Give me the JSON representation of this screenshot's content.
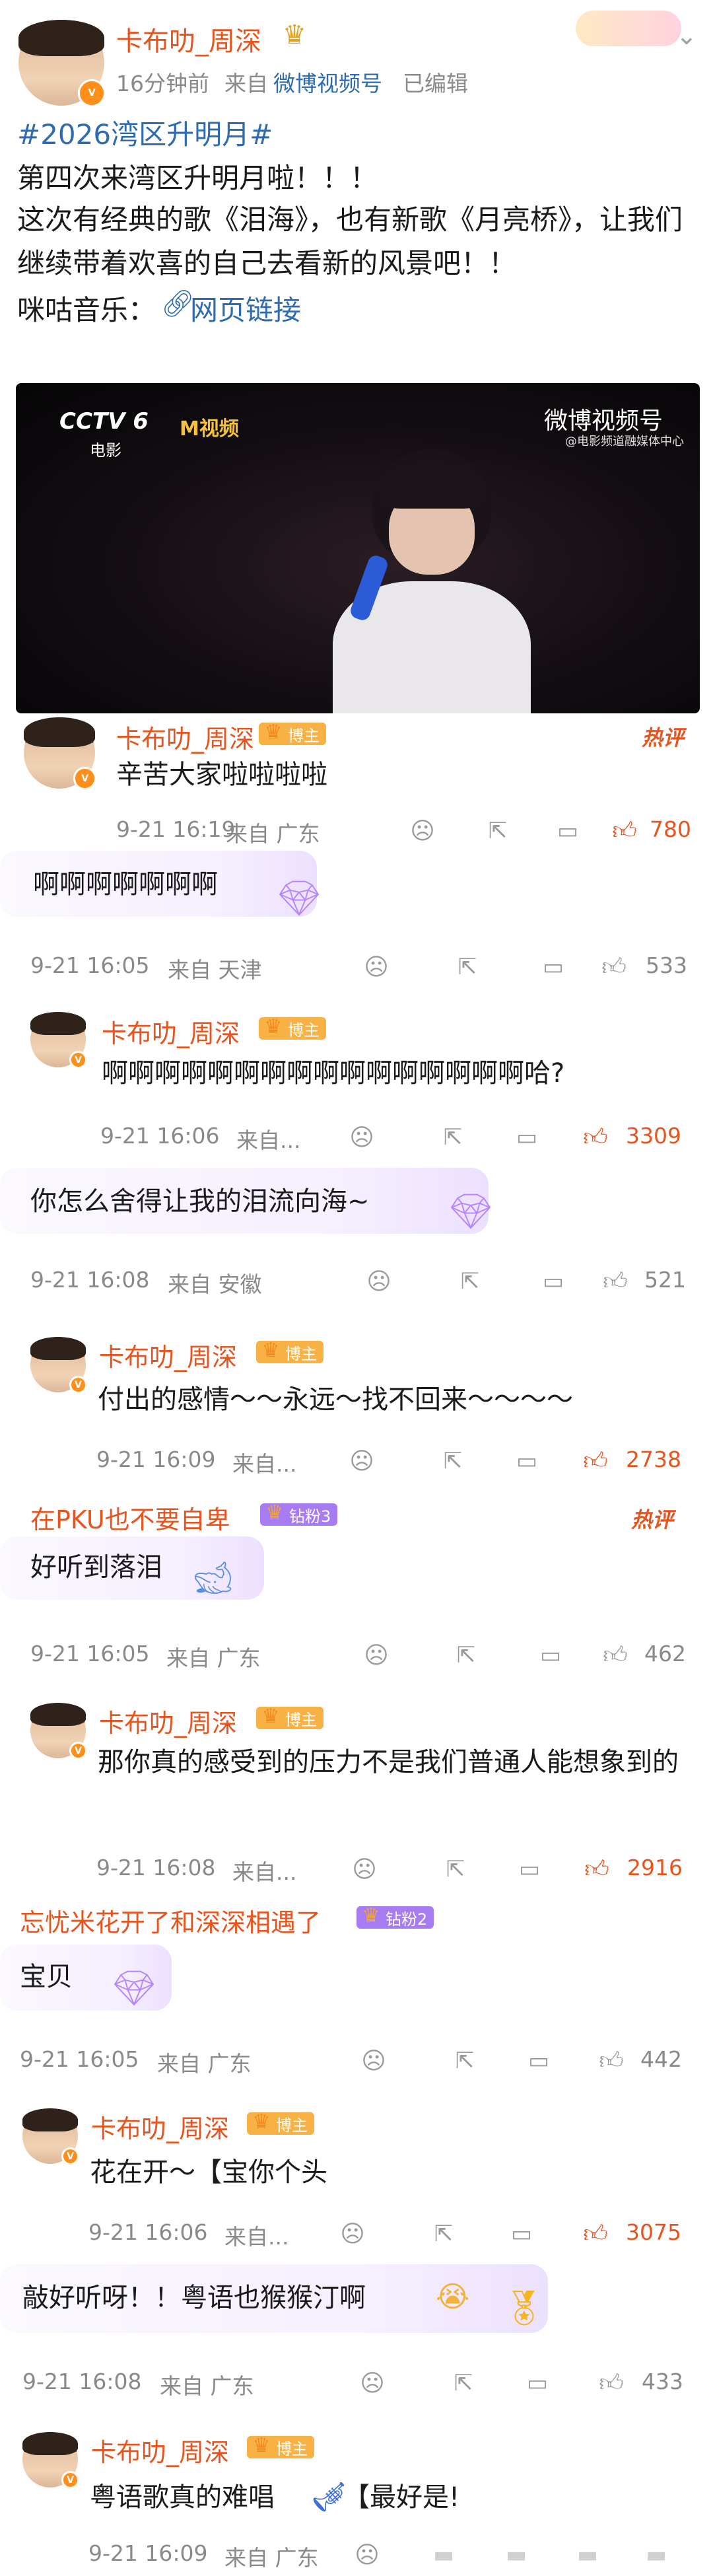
{
  "post": {
    "author": "卡布叻_周深",
    "time": "16分钟前",
    "source_prefix": "来自",
    "source": "微博视频号",
    "edited": "已编辑",
    "hashtag": "#2026湾区升明月#",
    "line1": "第四次来湾区升明月啦！！！",
    "line2": "这次有经典的歌《泪海》，也有新歌《月亮桥》，让我们继续带着欢喜的自己去看新的风景吧！！",
    "music_label": "咪咕音乐：",
    "web_link": "网页链接",
    "video": {
      "channel_logo": "CCTV 6",
      "channel_sub": "电影",
      "brand2": "M视频",
      "weibo_video": "微博视频号",
      "weibo_video_sub": "@电影频道融媒体中心"
    }
  },
  "hot_label": "热评",
  "comments": [
    {
      "author": "卡布叻_周深",
      "badge": "博主",
      "text": "辛苦大家啦啦啦啦",
      "time": "9-21 16:19",
      "loc": "来自 广东",
      "likes": "780",
      "hot": true,
      "reply": false
    },
    {
      "author": "",
      "badge": "",
      "text": "啊啊啊啊啊啊啊",
      "time": "9-21 16:05",
      "loc": "来自 天津",
      "likes": "533",
      "hot": false,
      "reply": false
    },
    {
      "author": "卡布叻_周深",
      "badge": "博主",
      "text": "啊啊啊啊啊啊啊啊啊啊啊啊啊啊啊啊哈?",
      "time": "9-21 16:06",
      "loc": "来自...",
      "likes": "3309",
      "hot": true,
      "reply": true
    },
    {
      "author": "",
      "badge": "",
      "text": "你怎么舍得让我的泪流向海~",
      "time": "9-21 16:08",
      "loc": "来自 安徽",
      "likes": "521",
      "hot": false,
      "reply": false
    },
    {
      "author": "卡布叻_周深",
      "badge": "博主",
      "text": "付出的感情～～永远～找不回来～～～～",
      "time": "9-21 16:09",
      "loc": "来自...",
      "likes": "2738",
      "hot": true,
      "reply": true
    },
    {
      "author": "在PKU也不要自卑",
      "badge": "钻粉3",
      "text": "好听到落泪",
      "time": "9-21 16:05",
      "loc": "来自 广东",
      "likes": "462",
      "hot": false,
      "reply": false
    },
    {
      "author": "卡布叻_周深",
      "badge": "博主",
      "text": "那你真的感受到的压力不是我们普通人能想象到的",
      "time": "9-21 16:08",
      "loc": "来自...",
      "likes": "2916",
      "hot": true,
      "reply": true
    },
    {
      "author": "忘忧米花开了和深深相遇了",
      "badge": "钻粉2",
      "text": "宝贝",
      "time": "9-21 16:05",
      "loc": "来自 广东",
      "likes": "442",
      "hot": false,
      "reply": false
    },
    {
      "author": "卡布叻_周深",
      "badge": "博主",
      "text": "花在开～【宝你个头",
      "time": "9-21 16:06",
      "loc": "来自...",
      "likes": "3075",
      "hot": true,
      "reply": true
    },
    {
      "author": "",
      "badge": "",
      "text": "敲好听呀！！粤语也猴猴汀啊",
      "time": "9-21 16:08",
      "loc": "来自 广东",
      "likes": "433",
      "hot": false,
      "reply": false
    },
    {
      "author": "卡布叻_周深",
      "badge": "博主",
      "text": "粤语歌真的难唱",
      "text2": "【最好是!",
      "time": "9-21 16:09",
      "loc": "来自 广东",
      "likes": "",
      "hot": false,
      "reply": true
    }
  ],
  "colors": {
    "accent": "#e8541e",
    "link": "#2f6bb1",
    "meta": "#8a8a8a",
    "bozhu": "#f7b144",
    "fan": "#a77cf3"
  }
}
